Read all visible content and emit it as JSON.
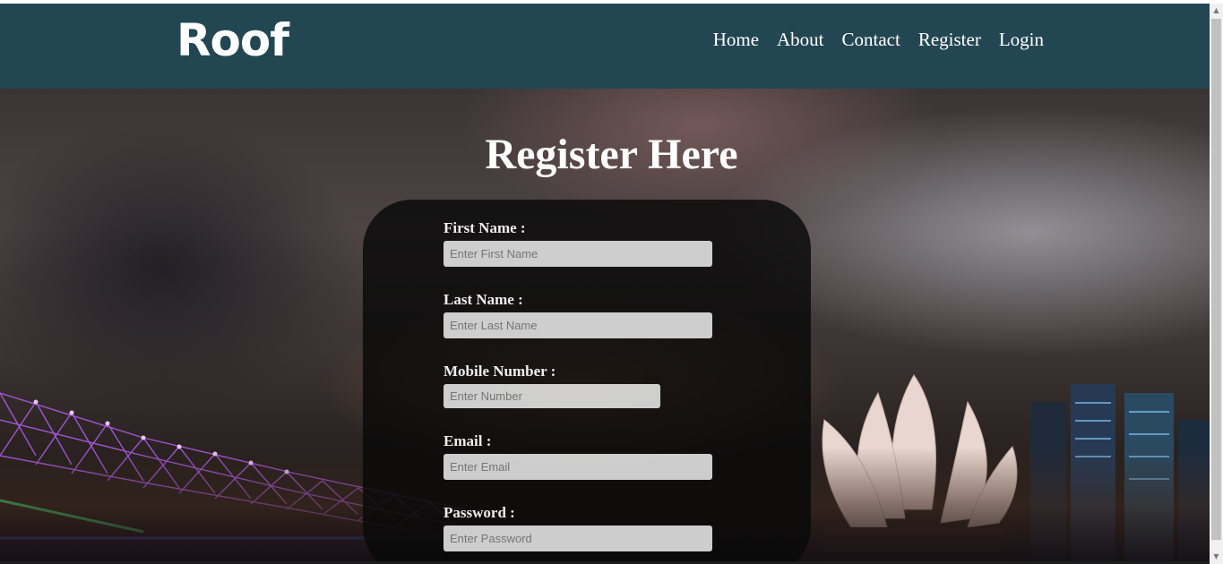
{
  "brand": "Roof",
  "nav": [
    "Home",
    "About",
    "Contact",
    "Register",
    "Login"
  ],
  "title": "Register Here",
  "form": {
    "first_name": {
      "label": "First Name :",
      "placeholder": "Enter First Name"
    },
    "last_name": {
      "label": "Last Name :",
      "placeholder": "Enter Last Name"
    },
    "mobile": {
      "label": "Mobile Number :",
      "placeholder": "Enter Number"
    },
    "email": {
      "label": "Email :",
      "placeholder": "Enter Email"
    },
    "password": {
      "label": "Password :",
      "placeholder": "Enter Password"
    }
  },
  "colors": {
    "navbar": "#234653",
    "panel": "#080808"
  },
  "scrollbar": {
    "up_icon": "scroll-up-arrow-icon",
    "down_icon": "scroll-down-arrow-icon"
  }
}
